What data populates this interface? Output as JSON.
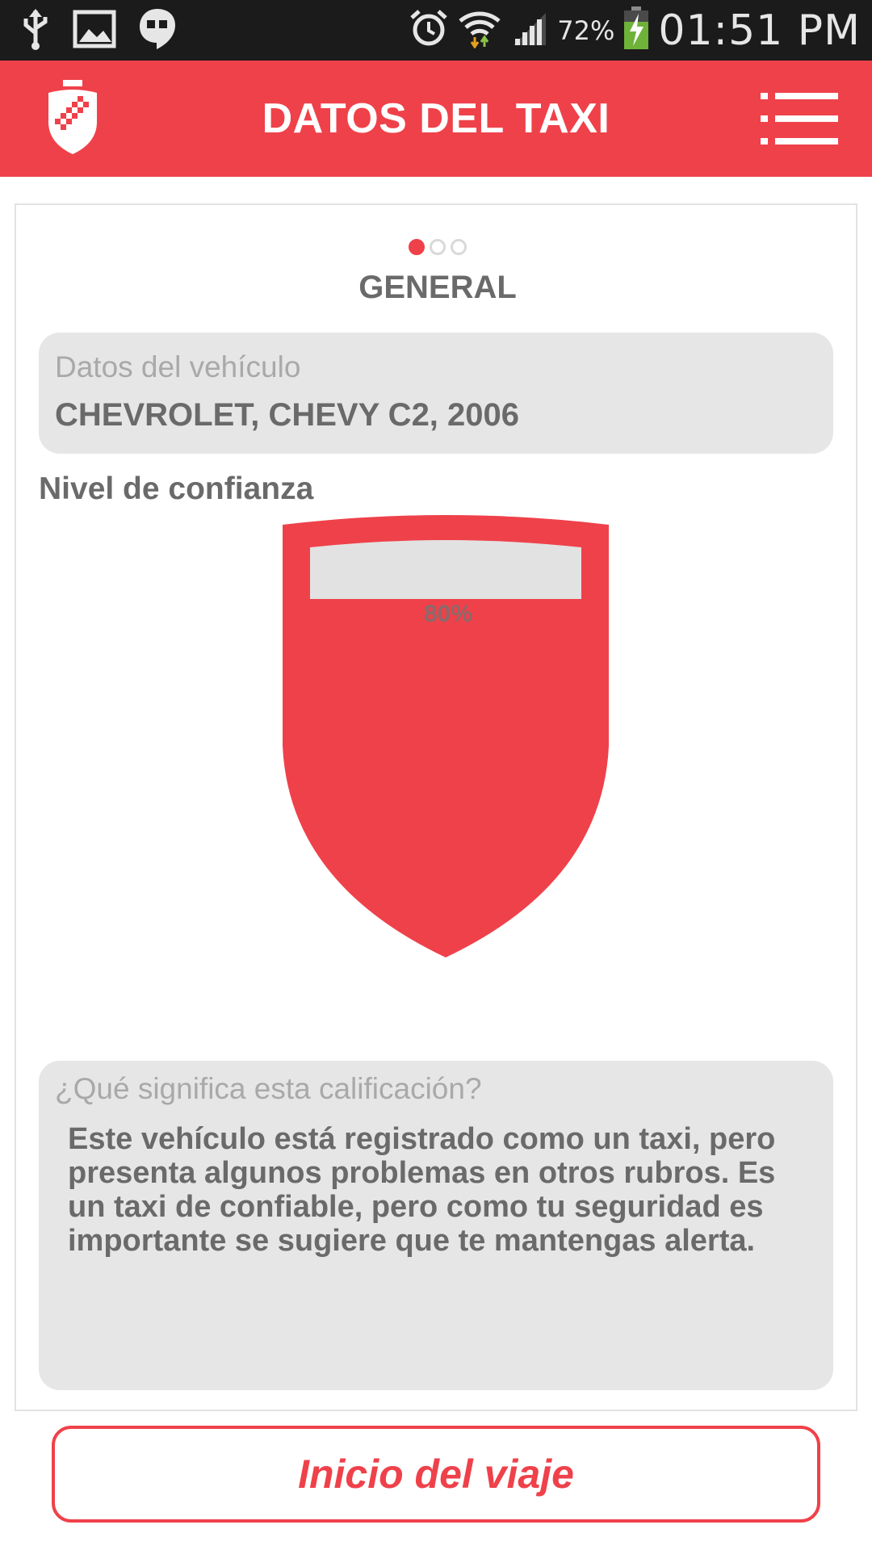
{
  "status_bar": {
    "battery_percent": "72%",
    "time": "01:51 PM",
    "icons": [
      "usb-icon",
      "image-icon",
      "hangouts-icon",
      "alarm-icon",
      "wifi-icon",
      "signal-icon",
      "battery-charging-icon"
    ]
  },
  "app_bar": {
    "title": "DATOS DEL TAXI",
    "logo_icon": "shield-logo-icon",
    "menu_icon": "menu-list-icon"
  },
  "colors": {
    "accent": "#ef414a",
    "panel": "#e6e6e6",
    "text_dark": "#6a6a6a",
    "text_muted": "#a9a9a9"
  },
  "pager": {
    "total_pages": 3,
    "current_page": 1
  },
  "section": {
    "title": "GENERAL"
  },
  "vehicle": {
    "label": "Datos del vehículo",
    "value": "CHEVROLET, CHEVY C2, 2006"
  },
  "trust": {
    "label": "Nivel de confianza",
    "percent_text": "80%",
    "level": 0.8
  },
  "description": {
    "label": "¿Qué significa esta calificación?",
    "text": "Este vehículo está registrado como un taxi, pero presenta algunos problemas en otros rubros. Es un taxi de confiable, pero como tu seguridad es importante se sugiere que te mantengas alerta."
  },
  "actions": {
    "start_trip_label": "Inicio del viaje"
  }
}
